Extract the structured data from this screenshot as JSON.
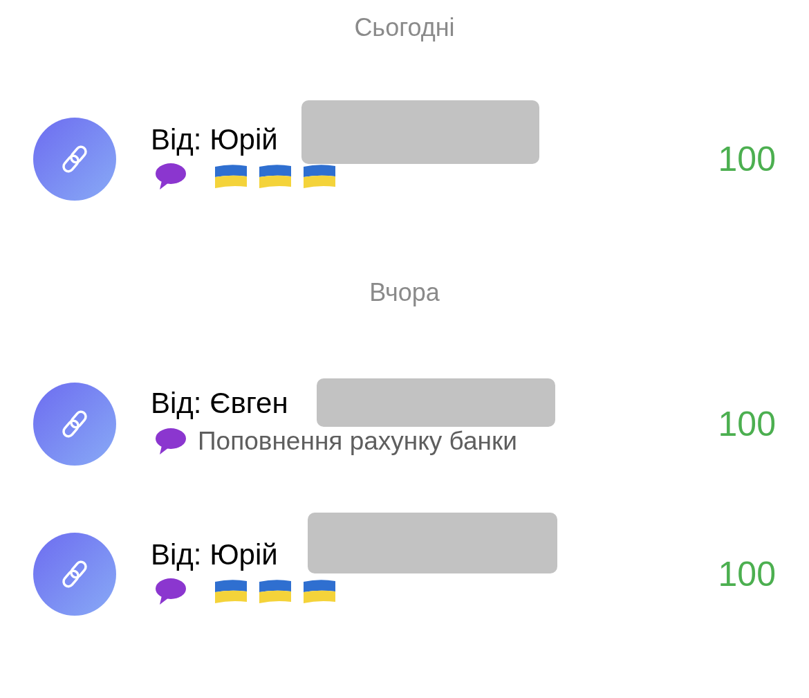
{
  "sections": [
    {
      "title": "Сьогодні",
      "transactions": [
        {
          "name": "Від: Юрій",
          "comment": {
            "kind": "flags"
          },
          "amount": "100"
        }
      ]
    },
    {
      "title": "Вчора",
      "transactions": [
        {
          "name": "Від: Євген",
          "comment": {
            "kind": "text",
            "text": "Поповнення рахунку банки"
          },
          "amount": "100"
        },
        {
          "name": "Від: Юрій",
          "comment": {
            "kind": "flags"
          },
          "amount": "100"
        }
      ]
    }
  ]
}
